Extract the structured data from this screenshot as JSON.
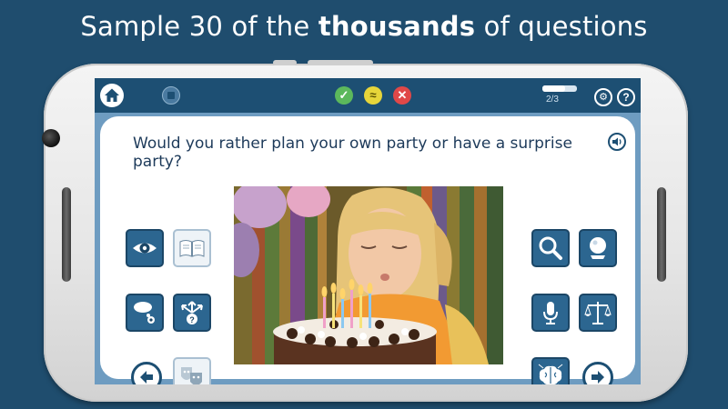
{
  "headline": {
    "part1": "Sample 30 of the ",
    "bold": "thousands",
    "part2": " of questions"
  },
  "topbar": {
    "home_icon": "home-icon",
    "stop_icon": "stop-icon",
    "answers": {
      "yes_symbol": "✓",
      "maybe_symbol": "≈",
      "no_symbol": "✕"
    },
    "progress": {
      "text": "2/3",
      "fraction": 0.67
    },
    "gear_symbol": "⚙",
    "help_symbol": "?"
  },
  "question": {
    "text": "Would you rather plan your own party or have a surprise party?"
  },
  "icons": {
    "left": [
      "eye-icon",
      "book-icon",
      "thought-bubble-icon",
      "decision-arrows-icon",
      "theater-masks-icon"
    ],
    "right": [
      "magnifier-icon",
      "crystal-ball-icon",
      "microphone-icon",
      "scales-icon",
      "brain-icon"
    ]
  },
  "colors": {
    "background": "#1f4d6e",
    "topbar": "#1d4f73",
    "tile": "#2c6690",
    "yes": "#5cb85c",
    "maybe": "#e7d53a",
    "no": "#e04848"
  }
}
